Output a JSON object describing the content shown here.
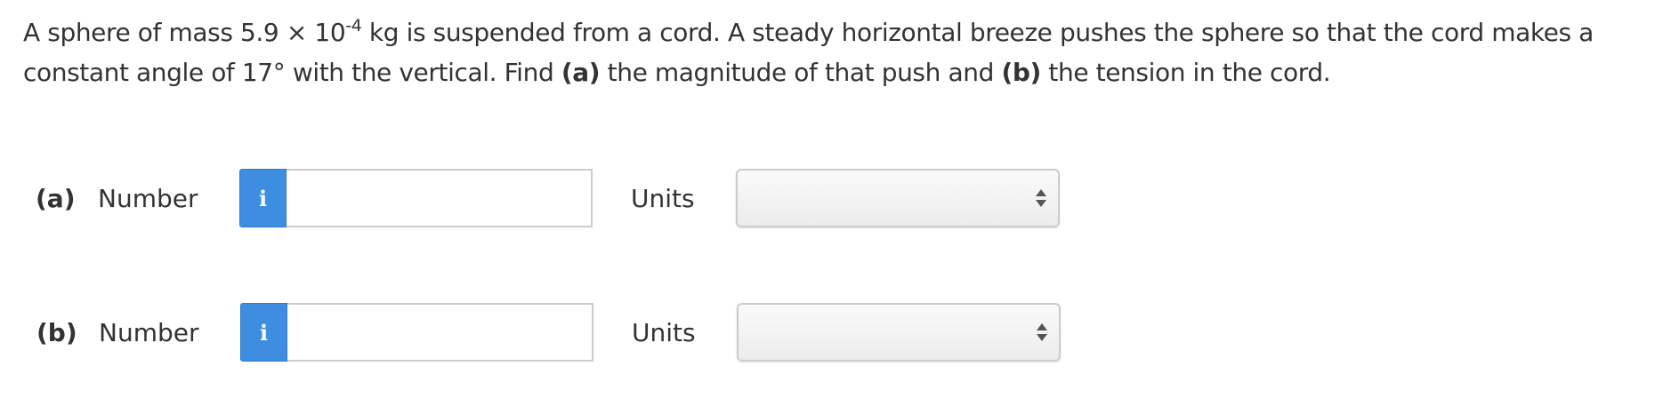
{
  "question": {
    "text_before_exp": "A sphere of mass 5.9 × 10",
    "exponent": "-4",
    "text_after_exp": " kg is suspended from a cord. A steady horizontal breeze pushes the sphere so that the cord makes a constant angle of 17° with the vertical. Find ",
    "part_a_marker": "(a)",
    "part_a_text": " the magnitude of that push and ",
    "part_b_marker": "(b)",
    "part_b_text": " the tension in the cord."
  },
  "rows": [
    {
      "part": "(a)",
      "number_label": "Number",
      "info_glyph": "i",
      "number_value": "",
      "units_label": "Units",
      "units_selected": ""
    },
    {
      "part": "(b)",
      "number_label": "Number",
      "info_glyph": "i",
      "number_value": "",
      "units_label": "Units",
      "units_selected": ""
    }
  ],
  "colors": {
    "info_button": "#3d8ee0",
    "text": "#333333",
    "border": "#cccccc"
  }
}
